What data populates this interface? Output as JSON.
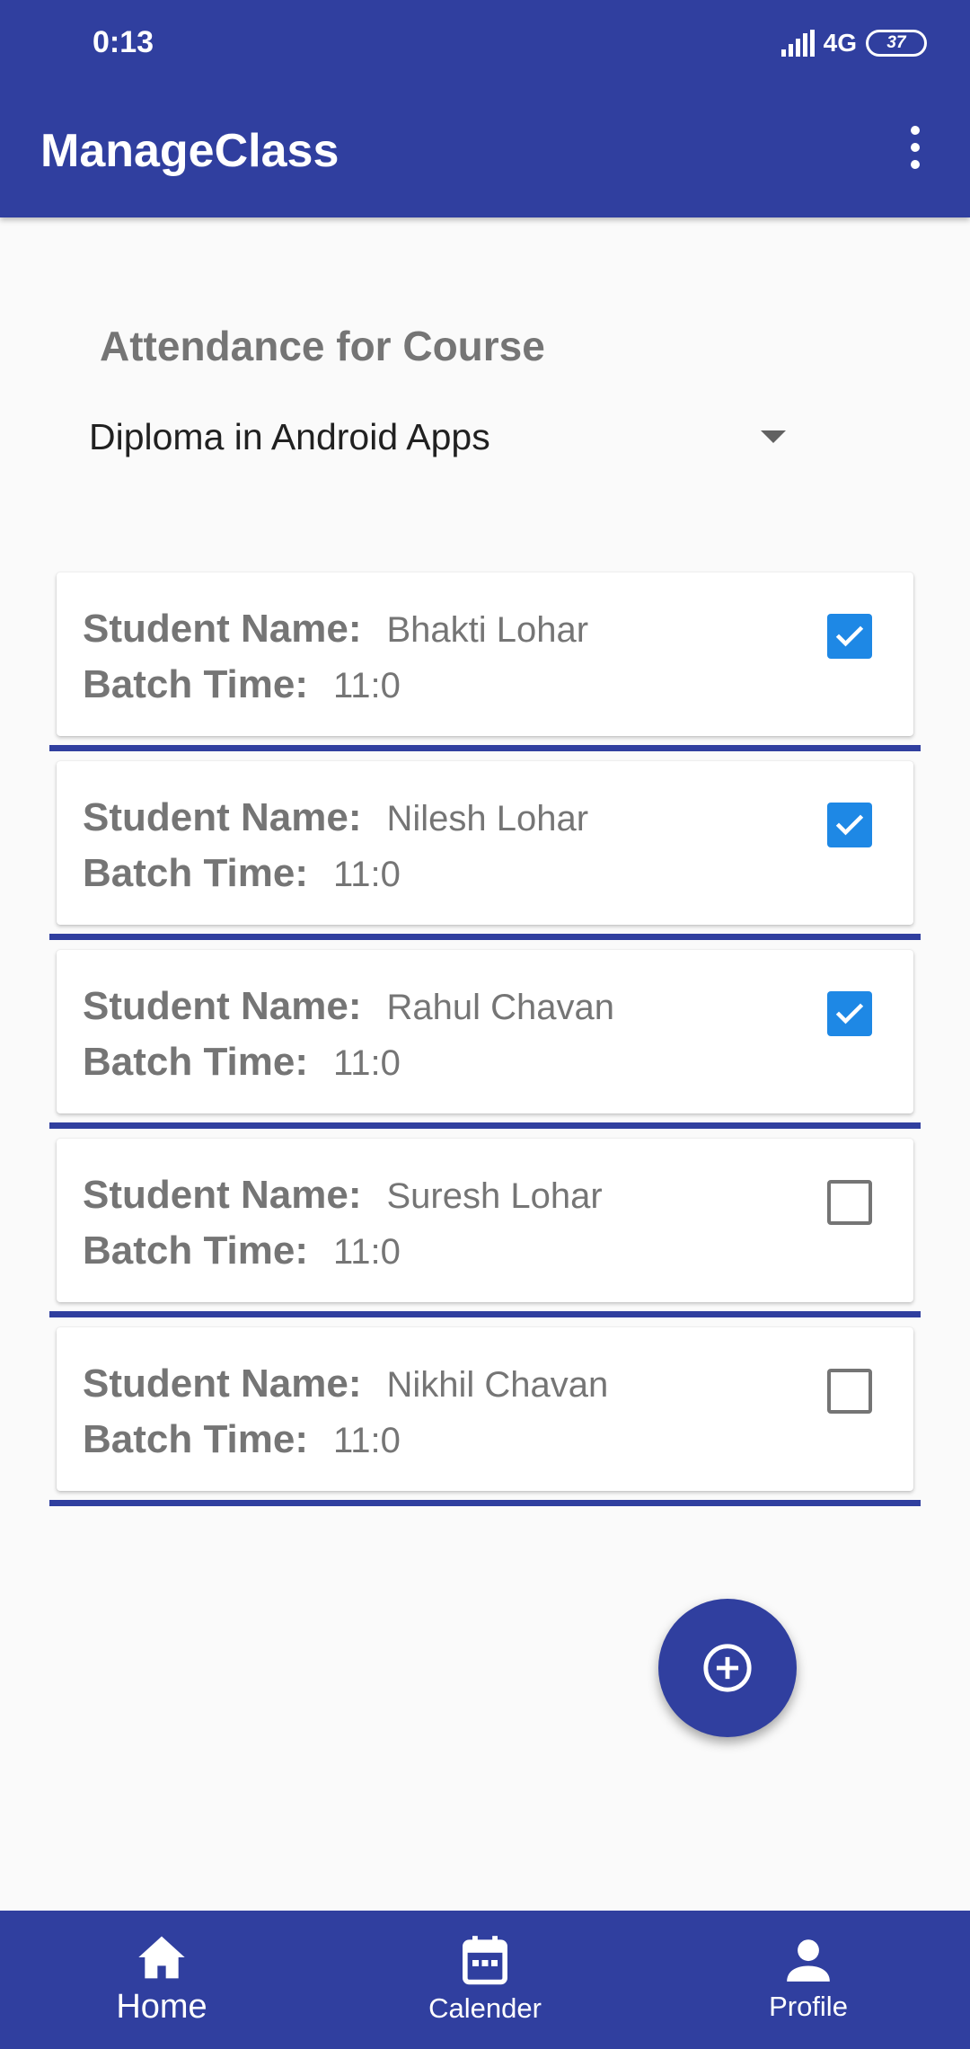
{
  "status_bar": {
    "time": "0:13",
    "network": "4G",
    "battery": "37"
  },
  "app_bar": {
    "title": "ManageClass",
    "menu_icon": "more-vert-icon"
  },
  "course_section": {
    "heading": "Attendance for Course",
    "selected_course": "Diploma in Android Apps"
  },
  "labels": {
    "student_name": "Student Name:",
    "batch_time": "Batch Time:"
  },
  "students": [
    {
      "name": "Bhakti Lohar",
      "batch_time": "11:0",
      "present": true
    },
    {
      "name": "Nilesh Lohar",
      "batch_time": "11:0",
      "present": true
    },
    {
      "name": "Rahul Chavan",
      "batch_time": "11:0",
      "present": true
    },
    {
      "name": "Suresh Lohar",
      "batch_time": "11:0",
      "present": false
    },
    {
      "name": "Nikhil Chavan",
      "batch_time": "11:0",
      "present": false
    }
  ],
  "fab": {
    "icon": "add-circle-icon"
  },
  "bottom_nav": {
    "items": [
      {
        "label": "Home",
        "icon": "home-icon",
        "active": true
      },
      {
        "label": "Calender",
        "icon": "calendar-icon",
        "active": false
      },
      {
        "label": "Profile",
        "icon": "person-icon",
        "active": false
      }
    ]
  },
  "colors": {
    "primary": "#303f9f",
    "checkbox_checked": "#1e88e5",
    "label_text": "#757575",
    "background": "#fafafa"
  }
}
